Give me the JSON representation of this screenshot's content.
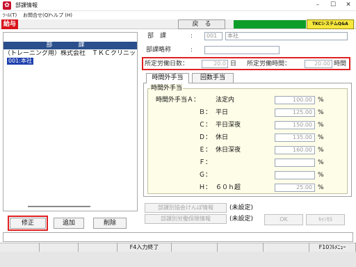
{
  "window": {
    "title": "部課情報",
    "minimize_glyph": "–",
    "maximize_glyph": "☐",
    "close_glyph": "✕"
  },
  "menu": [
    {
      "label": "ﾂｰﾙ(T)"
    },
    {
      "label": "お問合せ(Q)"
    },
    {
      "label": "ヘルプ (H)"
    }
  ],
  "header": {
    "module": "給与",
    "back_button": "戻　る",
    "tkc_button": "TKCシステムQ&A"
  },
  "left": {
    "heading": "部　課",
    "company": "（トレーニング用）株式会社　ＴＫＣクリニック",
    "department": "001:本社",
    "buttons": {
      "edit": "修正",
      "add": "追加",
      "delete": "削除"
    }
  },
  "form": {
    "dept_label": "部　課",
    "dept_colon": ":",
    "dept_code": "001",
    "dept_name": "本社",
    "abbr_label": "部課略称",
    "abbr_colon": ":",
    "abbr_value": "",
    "days_label": "所定労働日数：",
    "days_value": "20.0",
    "days_unit": "日",
    "hours_label": "所定労働時間：",
    "hours_value": "20.00",
    "hours_unit": "時間"
  },
  "tabs": [
    {
      "label": "時間外手当",
      "active": true
    },
    {
      "label": "回数手当",
      "active": false
    }
  ],
  "overtime": {
    "group_title": "時間外手当",
    "rows": [
      {
        "label": "時間外手当Ａ：",
        "name": "法定内",
        "value": "100.00",
        "unit": "%"
      },
      {
        "label": "Ｂ：",
        "name": "平日",
        "value": "125.00",
        "unit": "%"
      },
      {
        "label": "Ｃ：",
        "name": "平日深夜",
        "value": "150.00",
        "unit": "%"
      },
      {
        "label": "Ｄ：",
        "name": "休日",
        "value": "135.00",
        "unit": "%"
      },
      {
        "label": "Ｅ：",
        "name": "休日深夜",
        "value": "160.00",
        "unit": "%"
      },
      {
        "label": "Ｆ：",
        "name": "",
        "value": "",
        "unit": "%"
      },
      {
        "label": "Ｇ：",
        "name": "",
        "value": "",
        "unit": "%"
      },
      {
        "label": "Ｈ：",
        "name": "６０ｈ超",
        "value": "25.00",
        "unit": "%"
      }
    ]
  },
  "bottom": {
    "kenpo_button": "部課別協会けんぽ情報",
    "kenpo_status": "(未設定)",
    "rousai_button": "部課別労働保険情報",
    "rousai_status": "(未設定)",
    "ok": "OK",
    "cancel": "ｷｬﾝｾﾙ"
  },
  "fkeys": {
    "f4": "F4入力終了",
    "f10": "F10ﾌﾙﾒﾆｭｰ"
  },
  "colors": {
    "module_red": "#d8141c",
    "selection_blue": "#1e3fae",
    "heading_blue": "#2a4f8c",
    "tkc_yellow": "#f6e73d",
    "status_green": "#0d9e2a",
    "highlight_red": "#e02020",
    "group_bg": "#fefde8"
  }
}
